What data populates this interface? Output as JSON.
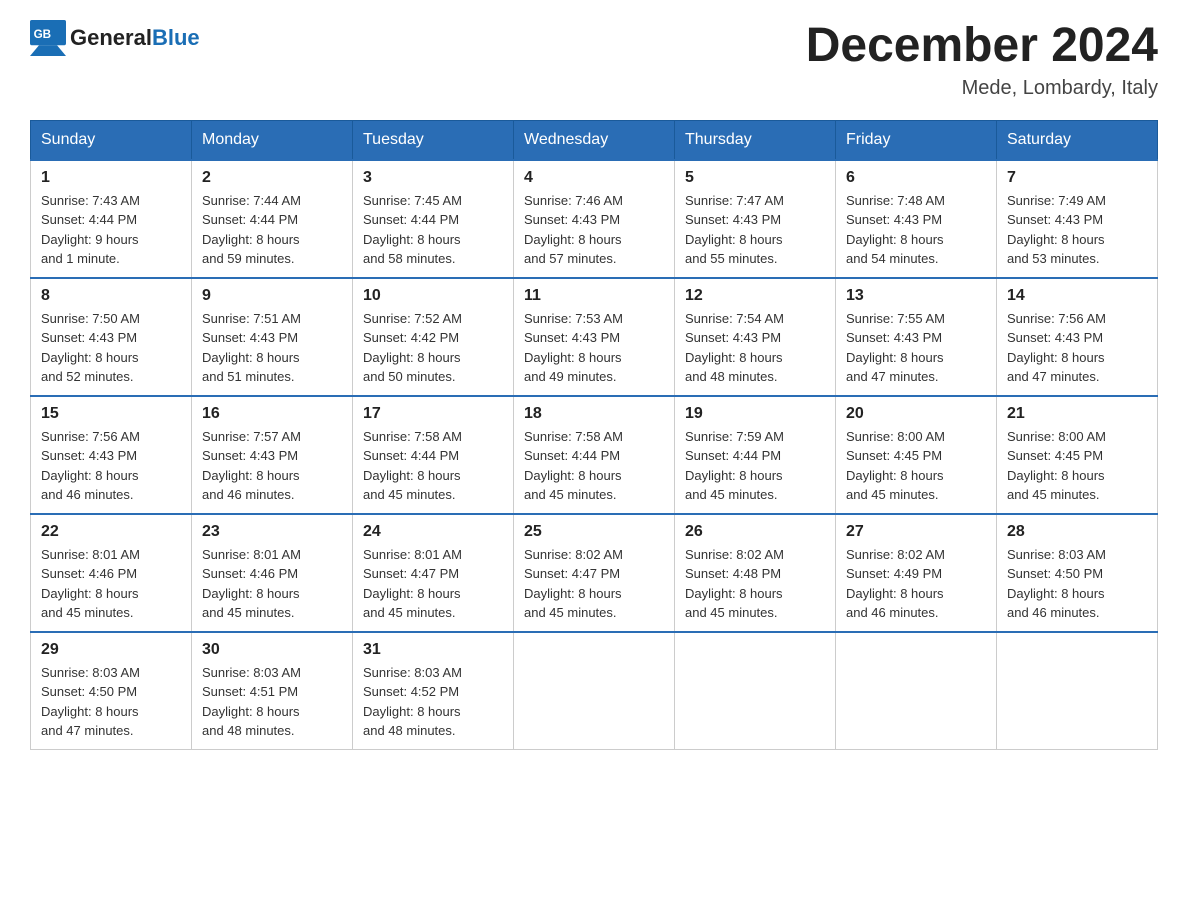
{
  "logo": {
    "text_general": "General",
    "text_blue": "Blue"
  },
  "header": {
    "month_title": "December 2024",
    "location": "Mede, Lombardy, Italy"
  },
  "weekdays": [
    "Sunday",
    "Monday",
    "Tuesday",
    "Wednesday",
    "Thursday",
    "Friday",
    "Saturday"
  ],
  "weeks": [
    [
      {
        "day": "1",
        "sunrise": "7:43 AM",
        "sunset": "4:44 PM",
        "daylight": "9 hours and 1 minute."
      },
      {
        "day": "2",
        "sunrise": "7:44 AM",
        "sunset": "4:44 PM",
        "daylight": "8 hours and 59 minutes."
      },
      {
        "day": "3",
        "sunrise": "7:45 AM",
        "sunset": "4:44 PM",
        "daylight": "8 hours and 58 minutes."
      },
      {
        "day": "4",
        "sunrise": "7:46 AM",
        "sunset": "4:43 PM",
        "daylight": "8 hours and 57 minutes."
      },
      {
        "day": "5",
        "sunrise": "7:47 AM",
        "sunset": "4:43 PM",
        "daylight": "8 hours and 55 minutes."
      },
      {
        "day": "6",
        "sunrise": "7:48 AM",
        "sunset": "4:43 PM",
        "daylight": "8 hours and 54 minutes."
      },
      {
        "day": "7",
        "sunrise": "7:49 AM",
        "sunset": "4:43 PM",
        "daylight": "8 hours and 53 minutes."
      }
    ],
    [
      {
        "day": "8",
        "sunrise": "7:50 AM",
        "sunset": "4:43 PM",
        "daylight": "8 hours and 52 minutes."
      },
      {
        "day": "9",
        "sunrise": "7:51 AM",
        "sunset": "4:43 PM",
        "daylight": "8 hours and 51 minutes."
      },
      {
        "day": "10",
        "sunrise": "7:52 AM",
        "sunset": "4:42 PM",
        "daylight": "8 hours and 50 minutes."
      },
      {
        "day": "11",
        "sunrise": "7:53 AM",
        "sunset": "4:43 PM",
        "daylight": "8 hours and 49 minutes."
      },
      {
        "day": "12",
        "sunrise": "7:54 AM",
        "sunset": "4:43 PM",
        "daylight": "8 hours and 48 minutes."
      },
      {
        "day": "13",
        "sunrise": "7:55 AM",
        "sunset": "4:43 PM",
        "daylight": "8 hours and 47 minutes."
      },
      {
        "day": "14",
        "sunrise": "7:56 AM",
        "sunset": "4:43 PM",
        "daylight": "8 hours and 47 minutes."
      }
    ],
    [
      {
        "day": "15",
        "sunrise": "7:56 AM",
        "sunset": "4:43 PM",
        "daylight": "8 hours and 46 minutes."
      },
      {
        "day": "16",
        "sunrise": "7:57 AM",
        "sunset": "4:43 PM",
        "daylight": "8 hours and 46 minutes."
      },
      {
        "day": "17",
        "sunrise": "7:58 AM",
        "sunset": "4:44 PM",
        "daylight": "8 hours and 45 minutes."
      },
      {
        "day": "18",
        "sunrise": "7:58 AM",
        "sunset": "4:44 PM",
        "daylight": "8 hours and 45 minutes."
      },
      {
        "day": "19",
        "sunrise": "7:59 AM",
        "sunset": "4:44 PM",
        "daylight": "8 hours and 45 minutes."
      },
      {
        "day": "20",
        "sunrise": "8:00 AM",
        "sunset": "4:45 PM",
        "daylight": "8 hours and 45 minutes."
      },
      {
        "day": "21",
        "sunrise": "8:00 AM",
        "sunset": "4:45 PM",
        "daylight": "8 hours and 45 minutes."
      }
    ],
    [
      {
        "day": "22",
        "sunrise": "8:01 AM",
        "sunset": "4:46 PM",
        "daylight": "8 hours and 45 minutes."
      },
      {
        "day": "23",
        "sunrise": "8:01 AM",
        "sunset": "4:46 PM",
        "daylight": "8 hours and 45 minutes."
      },
      {
        "day": "24",
        "sunrise": "8:01 AM",
        "sunset": "4:47 PM",
        "daylight": "8 hours and 45 minutes."
      },
      {
        "day": "25",
        "sunrise": "8:02 AM",
        "sunset": "4:47 PM",
        "daylight": "8 hours and 45 minutes."
      },
      {
        "day": "26",
        "sunrise": "8:02 AM",
        "sunset": "4:48 PM",
        "daylight": "8 hours and 45 minutes."
      },
      {
        "day": "27",
        "sunrise": "8:02 AM",
        "sunset": "4:49 PM",
        "daylight": "8 hours and 46 minutes."
      },
      {
        "day": "28",
        "sunrise": "8:03 AM",
        "sunset": "4:50 PM",
        "daylight": "8 hours and 46 minutes."
      }
    ],
    [
      {
        "day": "29",
        "sunrise": "8:03 AM",
        "sunset": "4:50 PM",
        "daylight": "8 hours and 47 minutes."
      },
      {
        "day": "30",
        "sunrise": "8:03 AM",
        "sunset": "4:51 PM",
        "daylight": "8 hours and 48 minutes."
      },
      {
        "day": "31",
        "sunrise": "8:03 AM",
        "sunset": "4:52 PM",
        "daylight": "8 hours and 48 minutes."
      },
      null,
      null,
      null,
      null
    ]
  ],
  "labels": {
    "sunrise": "Sunrise:",
    "sunset": "Sunset:",
    "daylight": "Daylight:"
  }
}
